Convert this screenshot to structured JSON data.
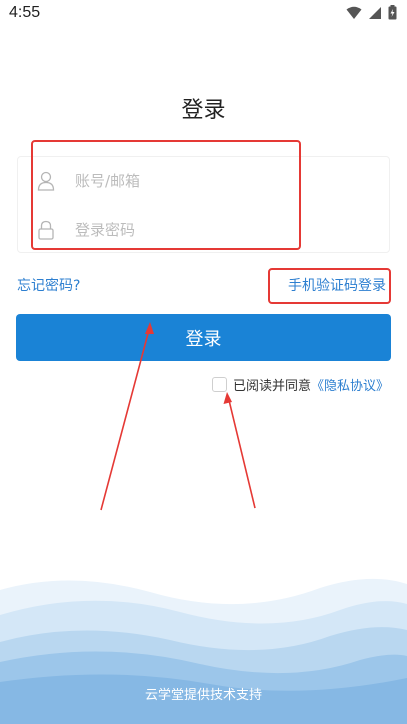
{
  "status_bar": {
    "time": "4:55",
    "icons": [
      "wifi-icon",
      "signal-icon",
      "battery-icon"
    ]
  },
  "page": {
    "title": "登录"
  },
  "form": {
    "account_placeholder": "账号/邮箱",
    "password_placeholder": "登录密码",
    "forgot_password_label": "忘记密码?",
    "sms_login_label": "手机验证码登录",
    "login_button_label": "登录"
  },
  "agreement": {
    "text": "已阅读并同意",
    "link_label": "《隐私协议》"
  },
  "footer": {
    "text": "云学堂提供技术支持"
  },
  "colors": {
    "primary": "#1a83d6",
    "link": "#2d7fd0",
    "annotation": "#e53935"
  }
}
